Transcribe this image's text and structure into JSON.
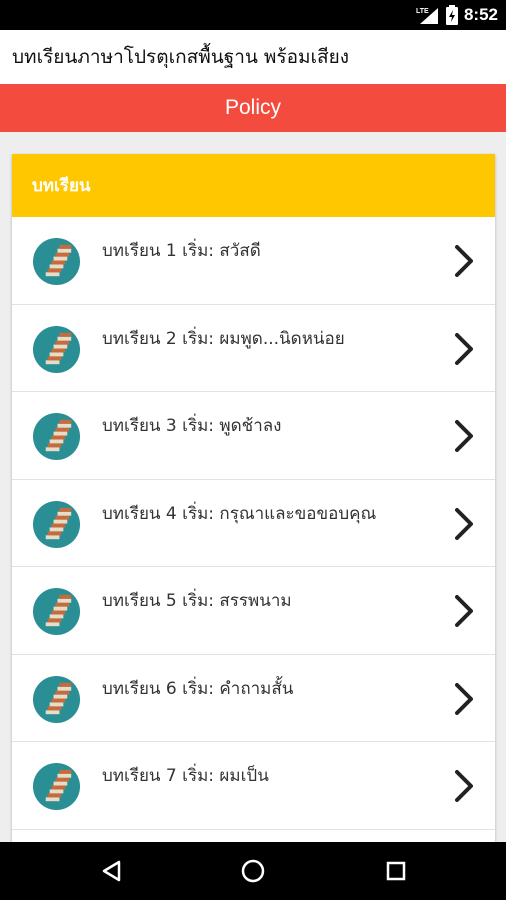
{
  "status_bar": {
    "time": "8:52",
    "icons": [
      "lte-signal-icon",
      "battery-icon"
    ]
  },
  "app": {
    "title": "บทเรียนภาษาโปรตุเกสพื้นฐาน พร้อมเสียง"
  },
  "policy": {
    "label": "Policy",
    "color": "#f44b3f"
  },
  "card": {
    "header_title": "บทเรียน",
    "header_color": "#ffc700",
    "items": [
      {
        "label": "บทเรียน 1 เริ่ม: สวัสดี",
        "icon": "stairs-icon"
      },
      {
        "label": "บทเรียน 2 เริ่ม: ผมพูด...นิดหน่อย",
        "icon": "stairs-icon"
      },
      {
        "label": "บทเรียน 3 เริ่ม: พูดช้าลง",
        "icon": "stairs-icon"
      },
      {
        "label": "บทเรียน 4 เริ่ม: กรุณาและขอขอบคุณ",
        "icon": "stairs-icon"
      },
      {
        "label": "บทเรียน 5 เริ่ม: สรรพนาม",
        "icon": "stairs-icon"
      },
      {
        "label": "บทเรียน 6 เริ่ม: คำถามสั้น",
        "icon": "stairs-icon"
      },
      {
        "label": "บทเรียน 7 เริ่ม: ผมเป็น",
        "icon": "stairs-icon"
      }
    ]
  },
  "nav_bar": {
    "buttons": [
      "back-icon",
      "home-icon",
      "recents-icon"
    ]
  }
}
